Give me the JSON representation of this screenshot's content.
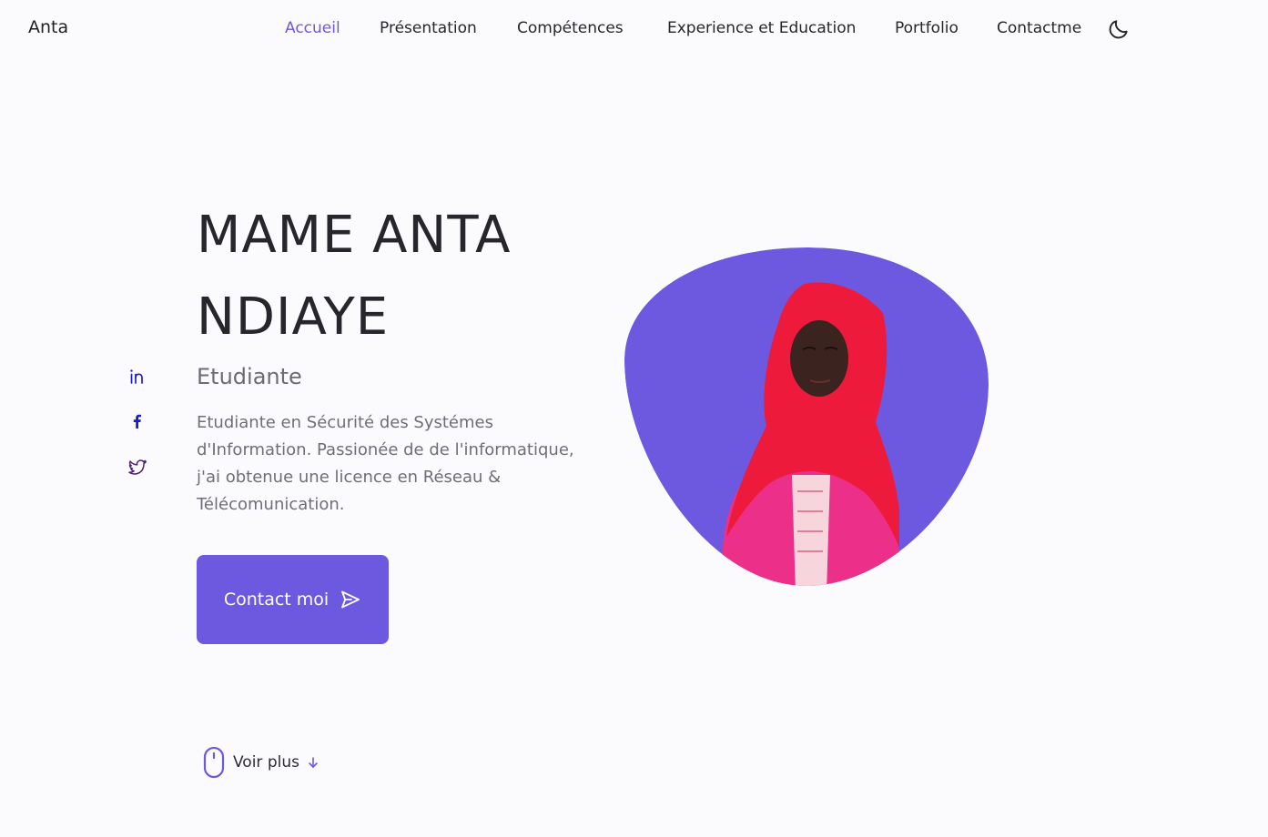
{
  "header": {
    "logo": "Anta",
    "nav": [
      {
        "label": "Accueil",
        "active": true
      },
      {
        "label": "Présentation",
        "active": false
      },
      {
        "label": "Compétences",
        "active": false
      },
      {
        "label": "Experience et Education",
        "active": false
      },
      {
        "label": "Portfolio",
        "active": false
      },
      {
        "label": "Contactme",
        "active": false
      }
    ],
    "theme_icon": "moon-icon"
  },
  "social": [
    {
      "name": "linkedin-icon"
    },
    {
      "name": "facebook-icon"
    },
    {
      "name": "twitter-icon"
    }
  ],
  "hero": {
    "title_line1": "MAME ANTA",
    "title_line2": "NDIAYE",
    "subtitle": "Etudiante",
    "description": "Etudiante en Sécurité des Systémes d'Information. Passionée de de l'informatique, j'ai obtenue une licence en Réseau & Télécomunication.",
    "button_label": "Contact moi",
    "button_icon": "send-icon"
  },
  "scroll": {
    "label": "Voir plus",
    "icons": [
      "mouse-icon",
      "arrow-down-icon"
    ]
  },
  "colors": {
    "accent": "#6d59e0",
    "text": "#26262c",
    "muted": "#6e6e78",
    "background": "#fbfbfd",
    "linkedin": "#1a1ad6",
    "facebook": "#1a1ad6",
    "twitter": "#4d1f7a"
  }
}
